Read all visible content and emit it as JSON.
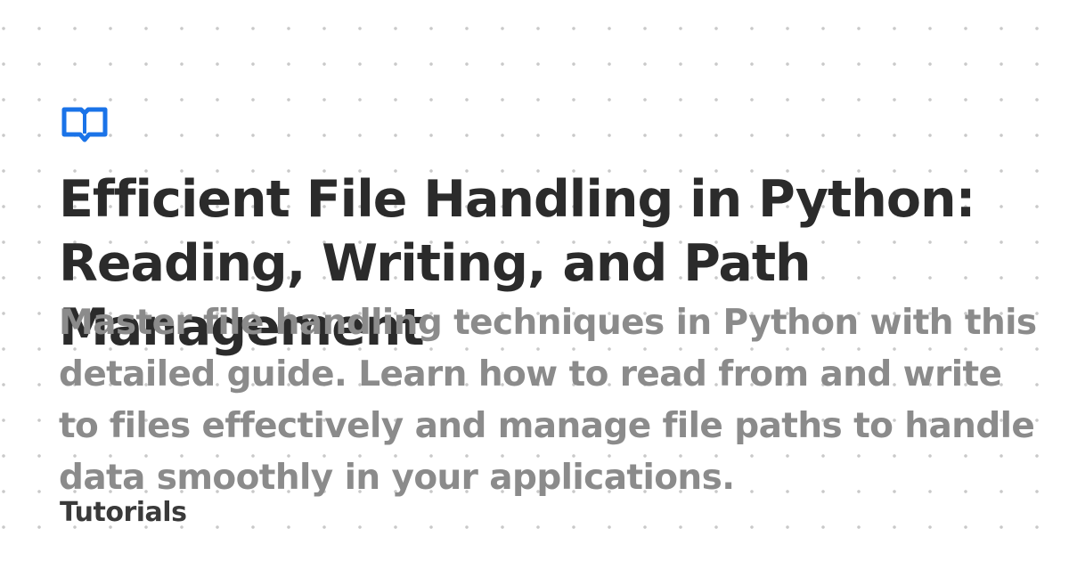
{
  "brand": {
    "icon": "open-book-icon",
    "accent_color": "#1a73e8"
  },
  "article": {
    "title": "Efficient File Handling in Python: Reading, Writing, and Path Management",
    "description": "Master file handling techniques in Python with this detailed guide. Learn how to read from and write to files effectively and manage file paths to handle data smoothly in your applications.",
    "category": "Tutorials"
  }
}
